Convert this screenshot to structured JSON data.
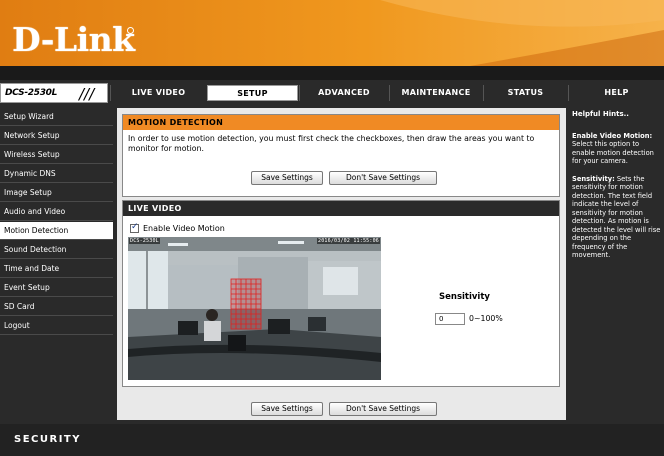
{
  "brand": {
    "logo": "D-Link",
    "model": "DCS-2530L",
    "slash": "///"
  },
  "nav": {
    "tabs": [
      "LIVE VIDEO",
      "SETUP",
      "ADVANCED",
      "MAINTENANCE",
      "STATUS",
      "HELP"
    ],
    "active": "SETUP"
  },
  "sidebar": {
    "items": [
      "Setup Wizard",
      "Network Setup",
      "Wireless Setup",
      "Dynamic DNS",
      "Image Setup",
      "Audio and Video",
      "Motion Detection",
      "Sound Detection",
      "Time and Date",
      "Event Setup",
      "SD Card",
      "Logout"
    ],
    "active": "Motion Detection"
  },
  "motion": {
    "title": "MOTION DETECTION",
    "intro": "In order to use motion detection, you must first check the checkboxes, then draw the areas you want to monitor for motion.",
    "save_label": "Save Settings",
    "dont_save_label": "Don't Save Settings"
  },
  "live": {
    "title": "LIVE VIDEO",
    "enable_label": "Enable Video Motion",
    "enabled": true,
    "ts_left": "DCS-2530L",
    "ts_right": "2016/03/02 11:55:06",
    "sensitivity_label": "Sensitivity",
    "sensitivity_value": "0",
    "sensitivity_range": "0~100%"
  },
  "bottom": {
    "save_label": "Save Settings",
    "dont_save_label": "Don't Save Settings"
  },
  "hints": {
    "title": "Helpful Hints..",
    "p1_bold": "Enable Video Motion:",
    "p1": "Select this option to enable motion detection for your camera.",
    "p2_bold": "Sensitivity:",
    "p2": "Sets the sensitivity for motion detection. The text field indicate the level of sensitivity for motion detection. As motion is detected the level will rise depending on the frequency of the movement."
  },
  "footer": {
    "text": "SECURITY"
  },
  "colors": {
    "accent": "#f08a24",
    "dark": "#2a2a2a",
    "grid": "#e02020"
  },
  "icons": {
    "checkbox": "check-icon"
  }
}
